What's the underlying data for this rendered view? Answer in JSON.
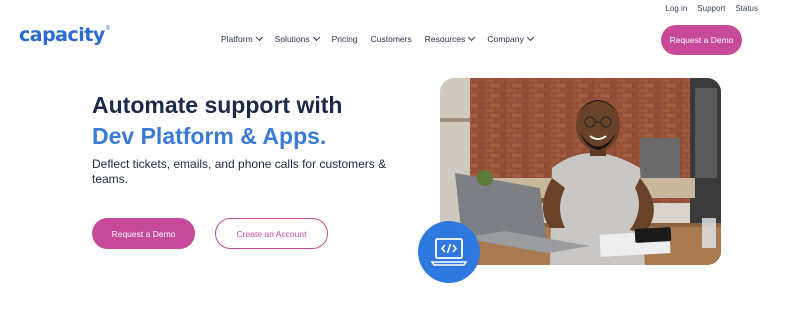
{
  "topbar": {
    "links": [
      "Log in",
      "Support",
      "Status"
    ]
  },
  "brand": {
    "name": "capacity",
    "registered_mark": "®",
    "color": "#2a6ad6"
  },
  "nav": {
    "items": [
      {
        "label": "Platform",
        "has_dropdown": true
      },
      {
        "label": "Solutions",
        "has_dropdown": true
      },
      {
        "label": "Pricing",
        "has_dropdown": false
      },
      {
        "label": "Customers",
        "has_dropdown": false
      },
      {
        "label": "Resources",
        "has_dropdown": true
      },
      {
        "label": "Company",
        "has_dropdown": true
      }
    ],
    "cta_label": "Request a Demo"
  },
  "hero": {
    "title": "Automate support with",
    "title_accent": "Dev Platform & Apps.",
    "subtitle": "Deflect tickets, emails, and phone calls for customers & teams.",
    "primary_button": "Request a Demo",
    "secondary_button": "Create an Account",
    "badge_icon": "code-laptop-icon"
  },
  "colors": {
    "accent_pink": "#c74a9a",
    "accent_blue": "#3a7bd8",
    "heading": "#1b2a4a"
  }
}
